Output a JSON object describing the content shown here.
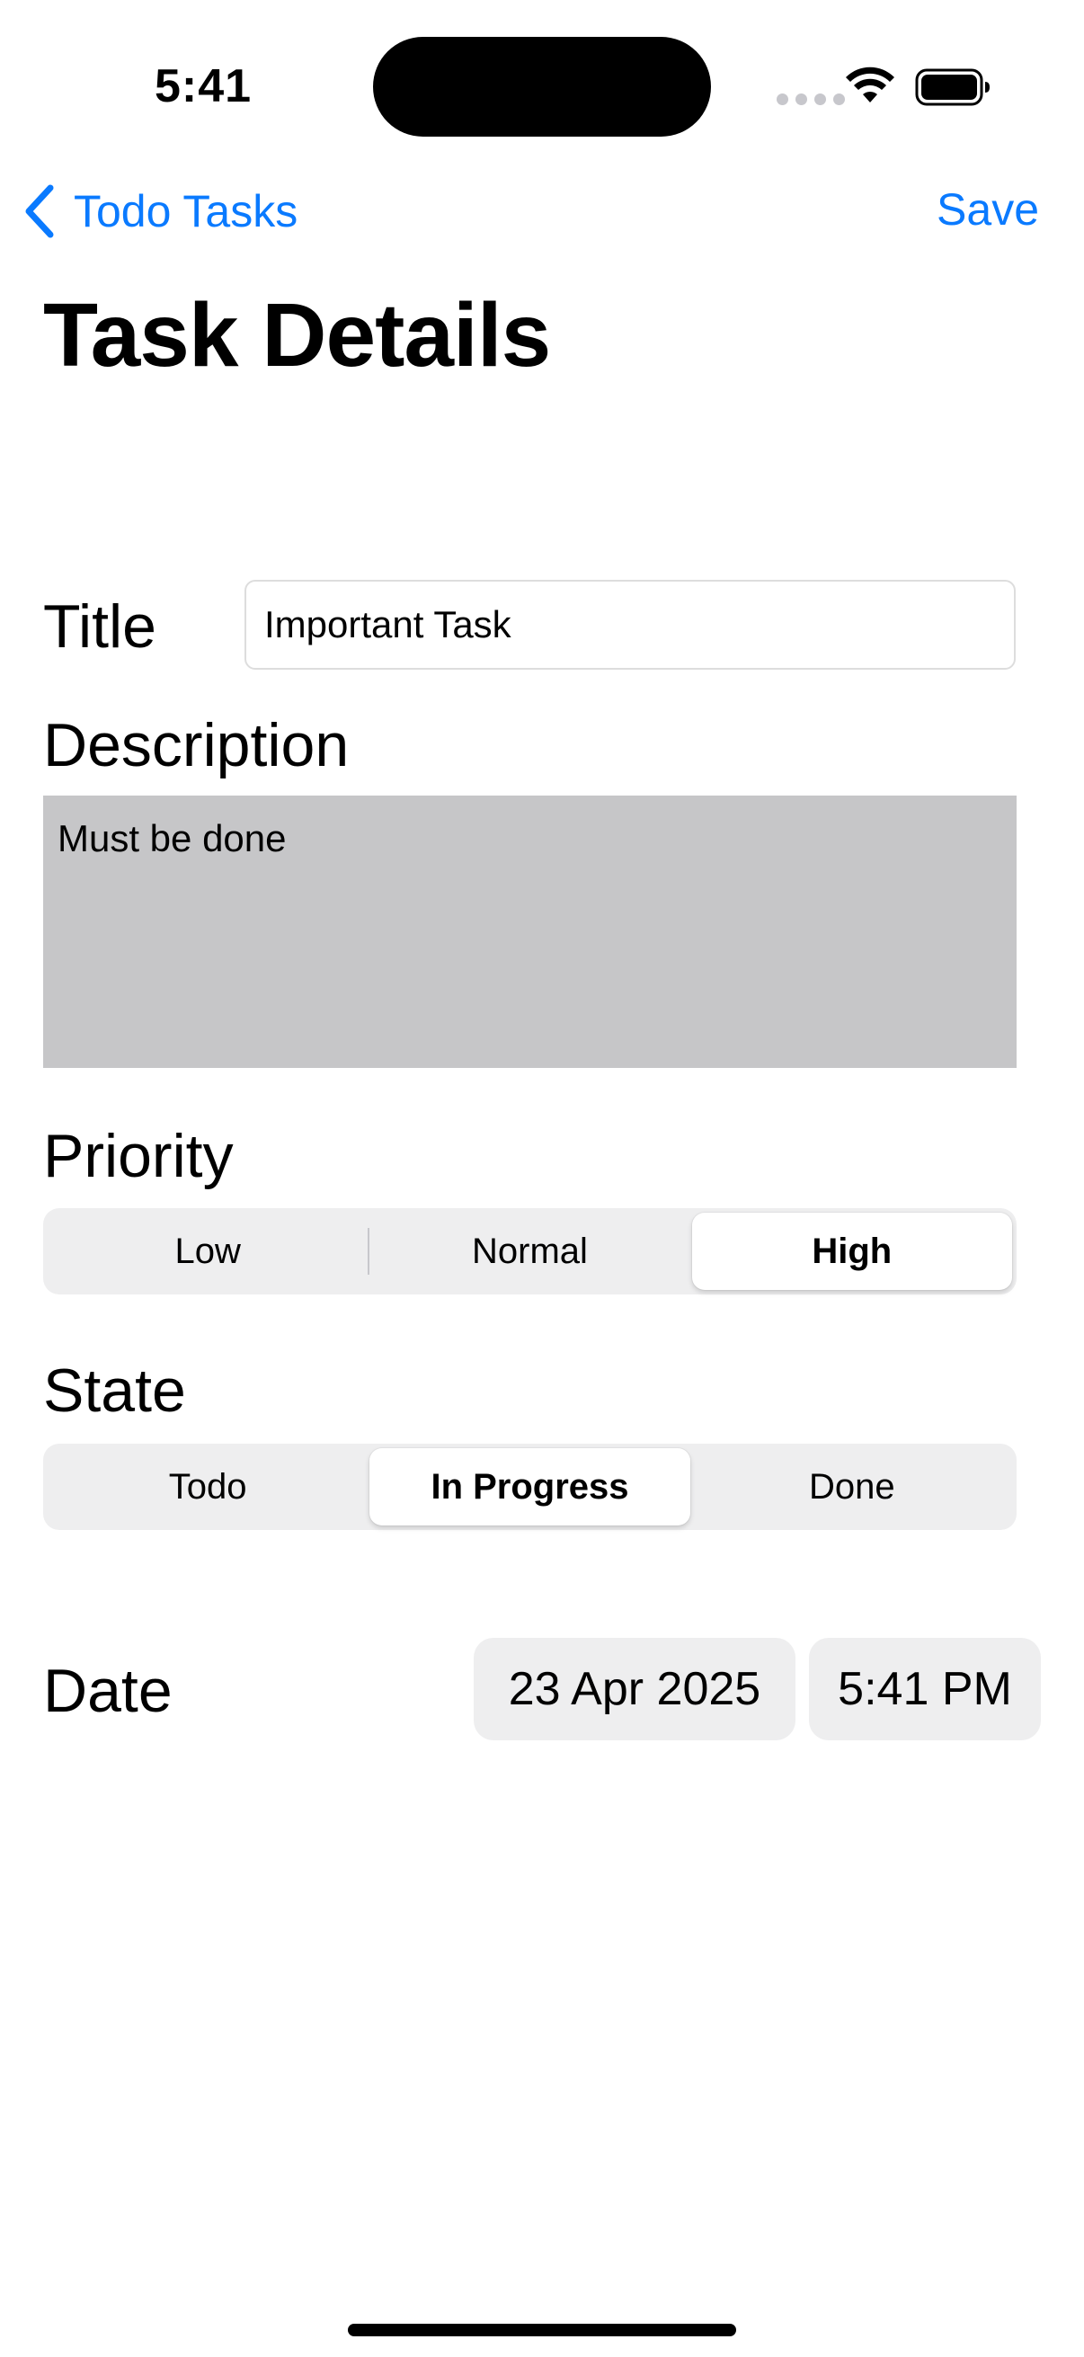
{
  "status_bar": {
    "time": "5:41"
  },
  "nav": {
    "back_label": "Todo Tasks",
    "save_label": "Save"
  },
  "page": {
    "title": "Task Details"
  },
  "form": {
    "title_label": "Title",
    "title_value": "Important Task",
    "description_label": "Description",
    "description_value": "Must be done",
    "priority_label": "Priority",
    "priority_options": [
      "Low",
      "Normal",
      "High"
    ],
    "priority_selected": "High",
    "state_label": "State",
    "state_options": [
      "Todo",
      "In Progress",
      "Done"
    ],
    "state_selected": "In Progress",
    "date_label": "Date",
    "date_value": "23 Apr 2025",
    "time_value": "5:41 PM"
  },
  "colors": {
    "accent": "#0a7aff",
    "segment_bg": "#eeeeef",
    "description_bg": "#c6c6c8"
  },
  "icons": {
    "back": "chevron-left-icon",
    "wifi": "wifi-icon",
    "battery": "battery-icon",
    "cellular": "cellular-signal-icon"
  }
}
